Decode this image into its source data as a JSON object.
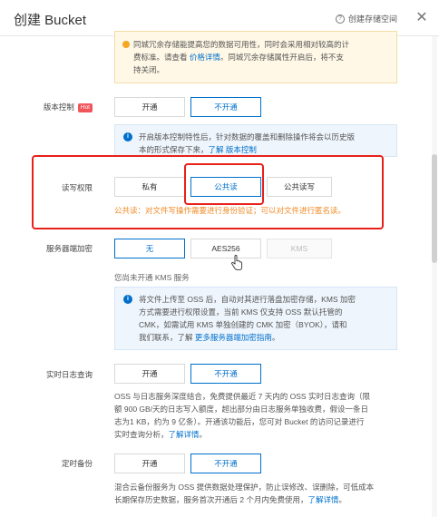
{
  "dialog": {
    "title": "创建 Bucket",
    "guide_label": "创建存储空间",
    "guide_icon": "question-circle-icon",
    "close_icon": "close-icon"
  },
  "redundancy_warning": {
    "line1": "同城冗余存储能提高您的数据可用性，同时会采用相对较高的计",
    "line2_prefix": "费标准。请查看 ",
    "line2_link": "价格详情",
    "line2_suffix": "。同城冗余存储属性开启后，将不支",
    "line3": "持关闭。"
  },
  "versioning": {
    "label": "版本控制",
    "badge": "Hot",
    "options": [
      "开通",
      "不开通"
    ],
    "selected": "不开通",
    "info_line1": "开启版本控制特性后，针对数据的覆盖和删除操作将会以历史版",
    "info_line2_prefix": "本的形式保存下来，",
    "info_link": "了解 版本控制"
  },
  "acl": {
    "label": "读写权限",
    "options": [
      "私有",
      "公共读",
      "公共读写"
    ],
    "selected": "公共读",
    "warning": "公共读：对文件写操作需要进行身份验证；可以对文件进行匿名读。"
  },
  "encryption": {
    "label": "服务器端加密",
    "options": [
      "无",
      "AES256",
      "KMS"
    ],
    "selected": "无",
    "disabled": [
      "KMS"
    ],
    "kms_note": "您尚未开通 KMS 服务",
    "info_line1": "将文件上传至 OSS 后，自动对其进行落盘加密存储，KMS 加密",
    "info_line2": "方式需要进行权限设置，当前 KMS 仅支持 OSS 默认托管的",
    "info_line3": "CMK，如需试用 KMS 单独创建的 CMK 加密（BYOK），请和",
    "info_line4_prefix": "我们联系，了解 ",
    "info_link": "更多服务器端加密指南",
    "info_line4_suffix": "。"
  },
  "realtime_log": {
    "label": "实时日志查询",
    "options": [
      "开通",
      "不开通"
    ],
    "selected": "不开通",
    "desc_line1": "OSS 与日志服务深度结合，免费提供最近 7 天内的 OSS 实时日志查询（限",
    "desc_line2": "额 900 GB/天的日志写入额度，超出部分由日志服务单独收费，假设一条日",
    "desc_line3": "志为1 KB，约为 9 亿条）。开通该功能后，您可对 Bucket 的访问记录进行",
    "desc_line4_prefix": "实时查询分析，",
    "desc_link": "了解详情",
    "desc_line4_suffix": "。"
  },
  "scheduled_backup": {
    "label": "定时备份",
    "options": [
      "开通",
      "不开通"
    ],
    "selected": "不开通",
    "desc_line1": "混合云备份服务为 OSS 提供数据处理保护，防止误修改、误删除，可低成本",
    "desc_line2_prefix": "长期保存历史数据，服务首次开通后 2 个月内免费使用，",
    "desc_link": "了解详情",
    "desc_line2_suffix": "。"
  },
  "colors": {
    "accent": "#0070cc",
    "highlight": "#e8211b",
    "warning": "#f08a24"
  }
}
